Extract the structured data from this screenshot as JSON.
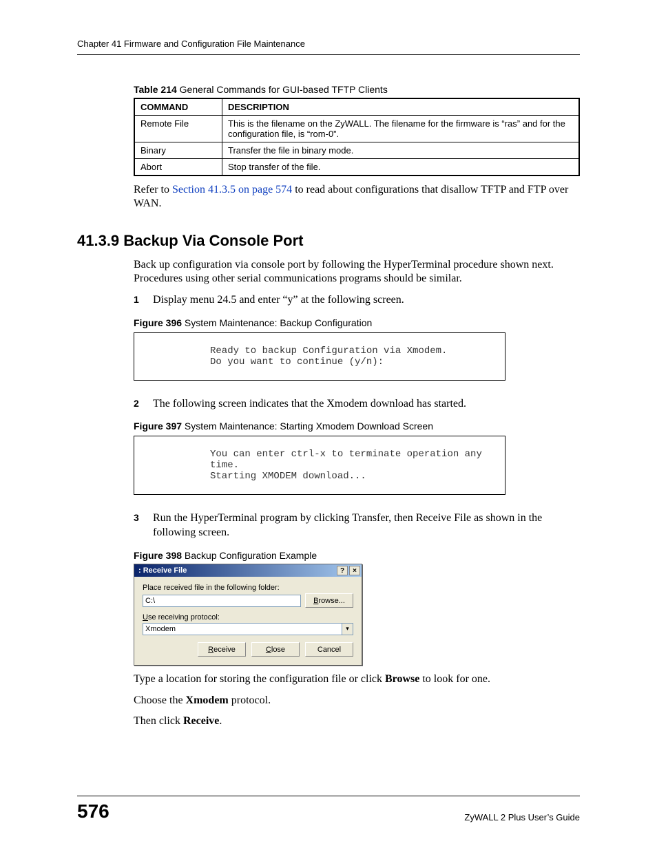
{
  "header": {
    "running": "Chapter 41 Firmware and Configuration File Maintenance"
  },
  "table214": {
    "caption_bold": "Table 214",
    "caption_rest": "   General Commands for GUI-based TFTP Clients",
    "head_col1": "COMMAND",
    "head_col2": "DESCRIPTION",
    "rows": [
      {
        "c1": "Remote File",
        "c2": "This is the filename on the ZyWALL. The filename for the firmware is “ras” and for the configuration file, is “rom-0”."
      },
      {
        "c1": "Binary",
        "c2": "Transfer the file in binary mode."
      },
      {
        "c1": "Abort",
        "c2": "Stop transfer of the file."
      }
    ]
  },
  "para_ref": {
    "pre": "Refer to ",
    "link": "Section 41.3.5 on page 574",
    "post": " to read about configurations that disallow TFTP and FTP over WAN."
  },
  "section_heading": "41.3.9  Backup Via Console Port",
  "intro": "Back up configuration via console port by following the HyperTerminal procedure shown next. Procedures using other serial communications programs should be similar.",
  "step1_num": "1",
  "step1": "Display menu 24.5 and enter “y” at the following screen.",
  "fig396": {
    "bold": "Figure 396",
    "rest": "   System Maintenance: Backup Configuration"
  },
  "code396": "Ready to backup Configuration via Xmodem.\nDo you want to continue (y/n):",
  "step2_num": "2",
  "step2": "The following screen indicates that the Xmodem download has started.",
  "fig397": {
    "bold": "Figure 397",
    "rest": "   System Maintenance: Starting Xmodem Download Screen"
  },
  "code397": "You can enter ctrl-x to terminate operation any time.\nStarting XMODEM download...",
  "step3_num": "3",
  "step3_pre": "Run the HyperTerminal program by clicking ",
  "step3_b1": "Transfer",
  "step3_mid": ", then ",
  "step3_b2": "Receive File",
  "step3_post": " as shown in the following screen.",
  "fig398": {
    "bold": "Figure 398",
    "rest": "   Backup Configuration Example"
  },
  "dialog": {
    "title": ": Receive File",
    "help_glyph": "?",
    "close_glyph": "×",
    "lbl_folder": "Place received file in the following folder:",
    "folder_value": "C:\\",
    "browse": "Browse...",
    "browse_u": "B",
    "lbl_protocol": "Use receiving protocol:",
    "lbl_protocol_u": "U",
    "protocol_value": "Xmodem",
    "dropdown_glyph": "▾",
    "btn_receive": "Receive",
    "btn_receive_u": "R",
    "btn_close": "Close",
    "btn_close_u": "C",
    "btn_cancel": "Cancel"
  },
  "tail1_pre": "Type a location for storing the configuration file or click ",
  "tail1_b": "Browse",
  "tail1_post": " to look for one.",
  "tail2_pre": "Choose the ",
  "tail2_b": "Xmodem",
  "tail2_post": " protocol.",
  "tail3_pre": "Then click ",
  "tail3_b": "Receive",
  "tail3_post": ".",
  "footer": {
    "page": "576",
    "guide": "ZyWALL 2 Plus User’s Guide"
  }
}
